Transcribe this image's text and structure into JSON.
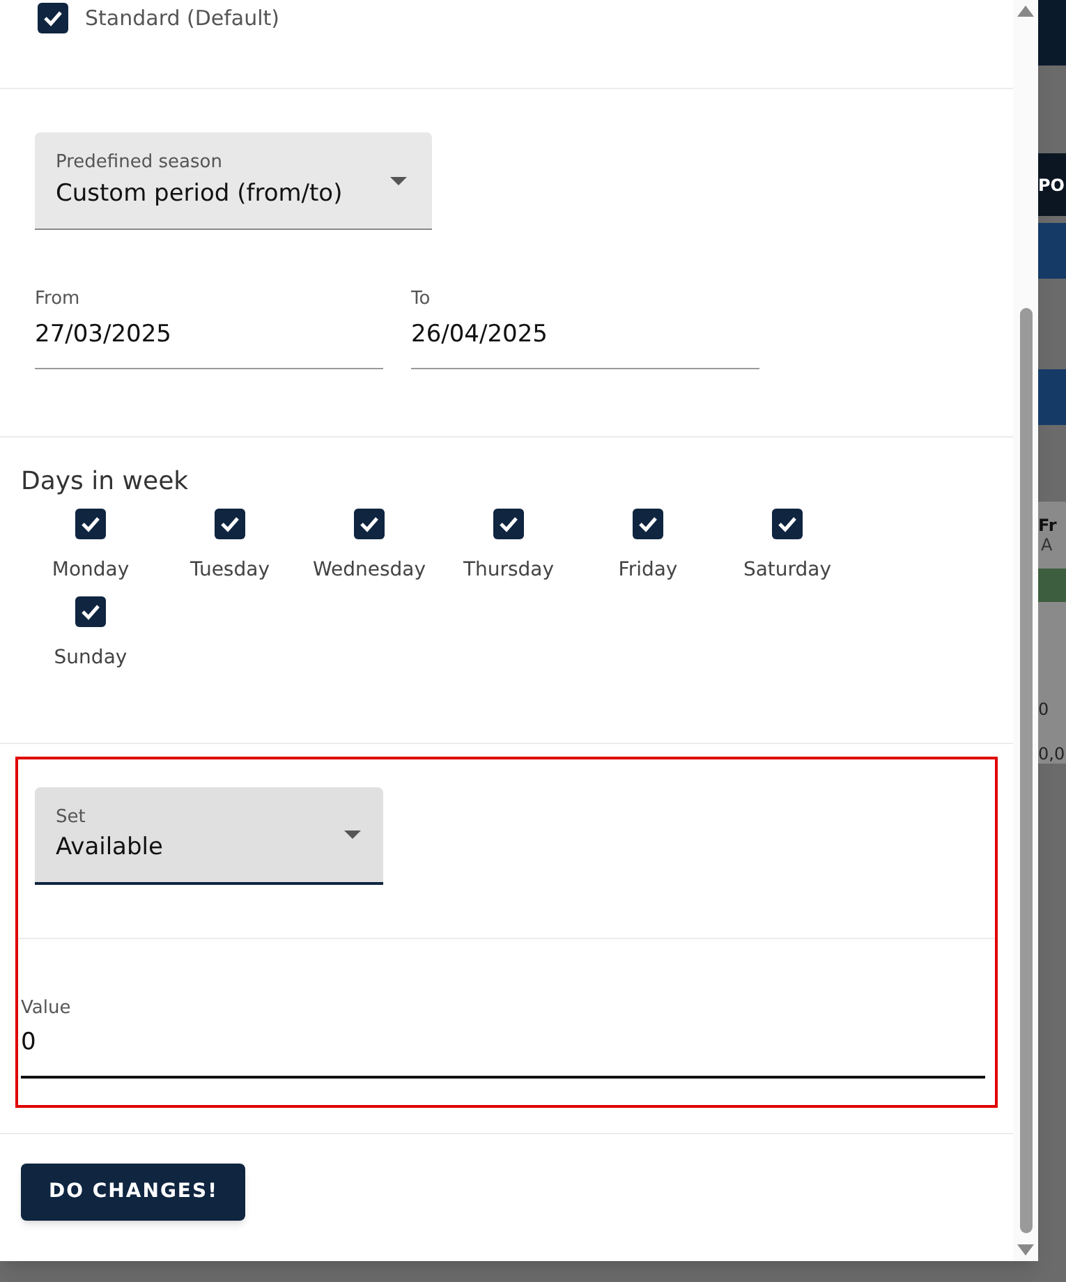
{
  "top_option": {
    "label": "Standard (Default)",
    "checked": true
  },
  "season": {
    "label": "Predefined season",
    "value": "Custom period (from/to)"
  },
  "from": {
    "label": "From",
    "value": "27/03/2025"
  },
  "to": {
    "label": "To",
    "value": "26/04/2025"
  },
  "days": {
    "title": "Days in week",
    "items": [
      {
        "label": "Monday",
        "checked": true
      },
      {
        "label": "Tuesday",
        "checked": true
      },
      {
        "label": "Wednesday",
        "checked": true
      },
      {
        "label": "Thursday",
        "checked": true
      },
      {
        "label": "Friday",
        "checked": true
      },
      {
        "label": "Saturday",
        "checked": true
      },
      {
        "label": "Sunday",
        "checked": true
      }
    ]
  },
  "set": {
    "label": "Set",
    "value": "Available"
  },
  "value_field": {
    "label": "Value",
    "value": "0"
  },
  "submit": "DO CHANGES!",
  "background": {
    "texts": [
      "PO",
      "Fr",
      "A",
      "0",
      "0,0"
    ]
  }
}
